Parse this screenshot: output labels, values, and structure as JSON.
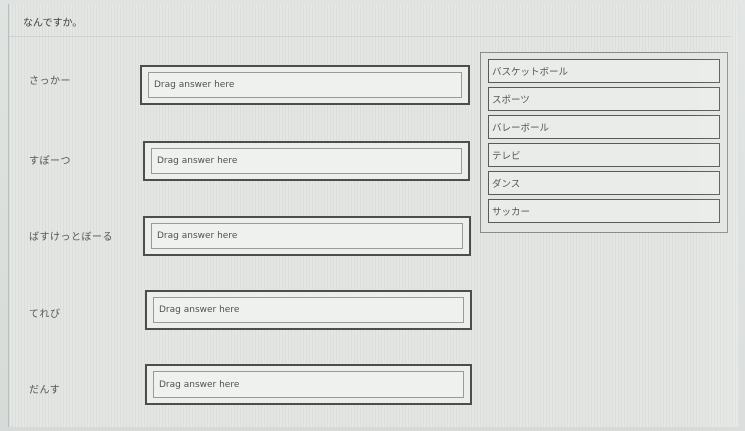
{
  "question": {
    "title": "なんですか。"
  },
  "prompts": [
    {
      "label": "さっかー",
      "drop_placeholder": "Drag answer here"
    },
    {
      "label": "すぽーつ",
      "drop_placeholder": "Drag answer here"
    },
    {
      "label": "ばすけっとぼーる",
      "drop_placeholder": "Drag answer here"
    },
    {
      "label": "てれび",
      "drop_placeholder": "Drag answer here"
    },
    {
      "label": "だんす",
      "drop_placeholder": "Drag answer here"
    }
  ],
  "choices": [
    {
      "label": "バスケットボール"
    },
    {
      "label": "スポーツ"
    },
    {
      "label": "バレーボール"
    },
    {
      "label": "テレビ"
    },
    {
      "label": "ダンス"
    },
    {
      "label": "サッカー"
    }
  ]
}
